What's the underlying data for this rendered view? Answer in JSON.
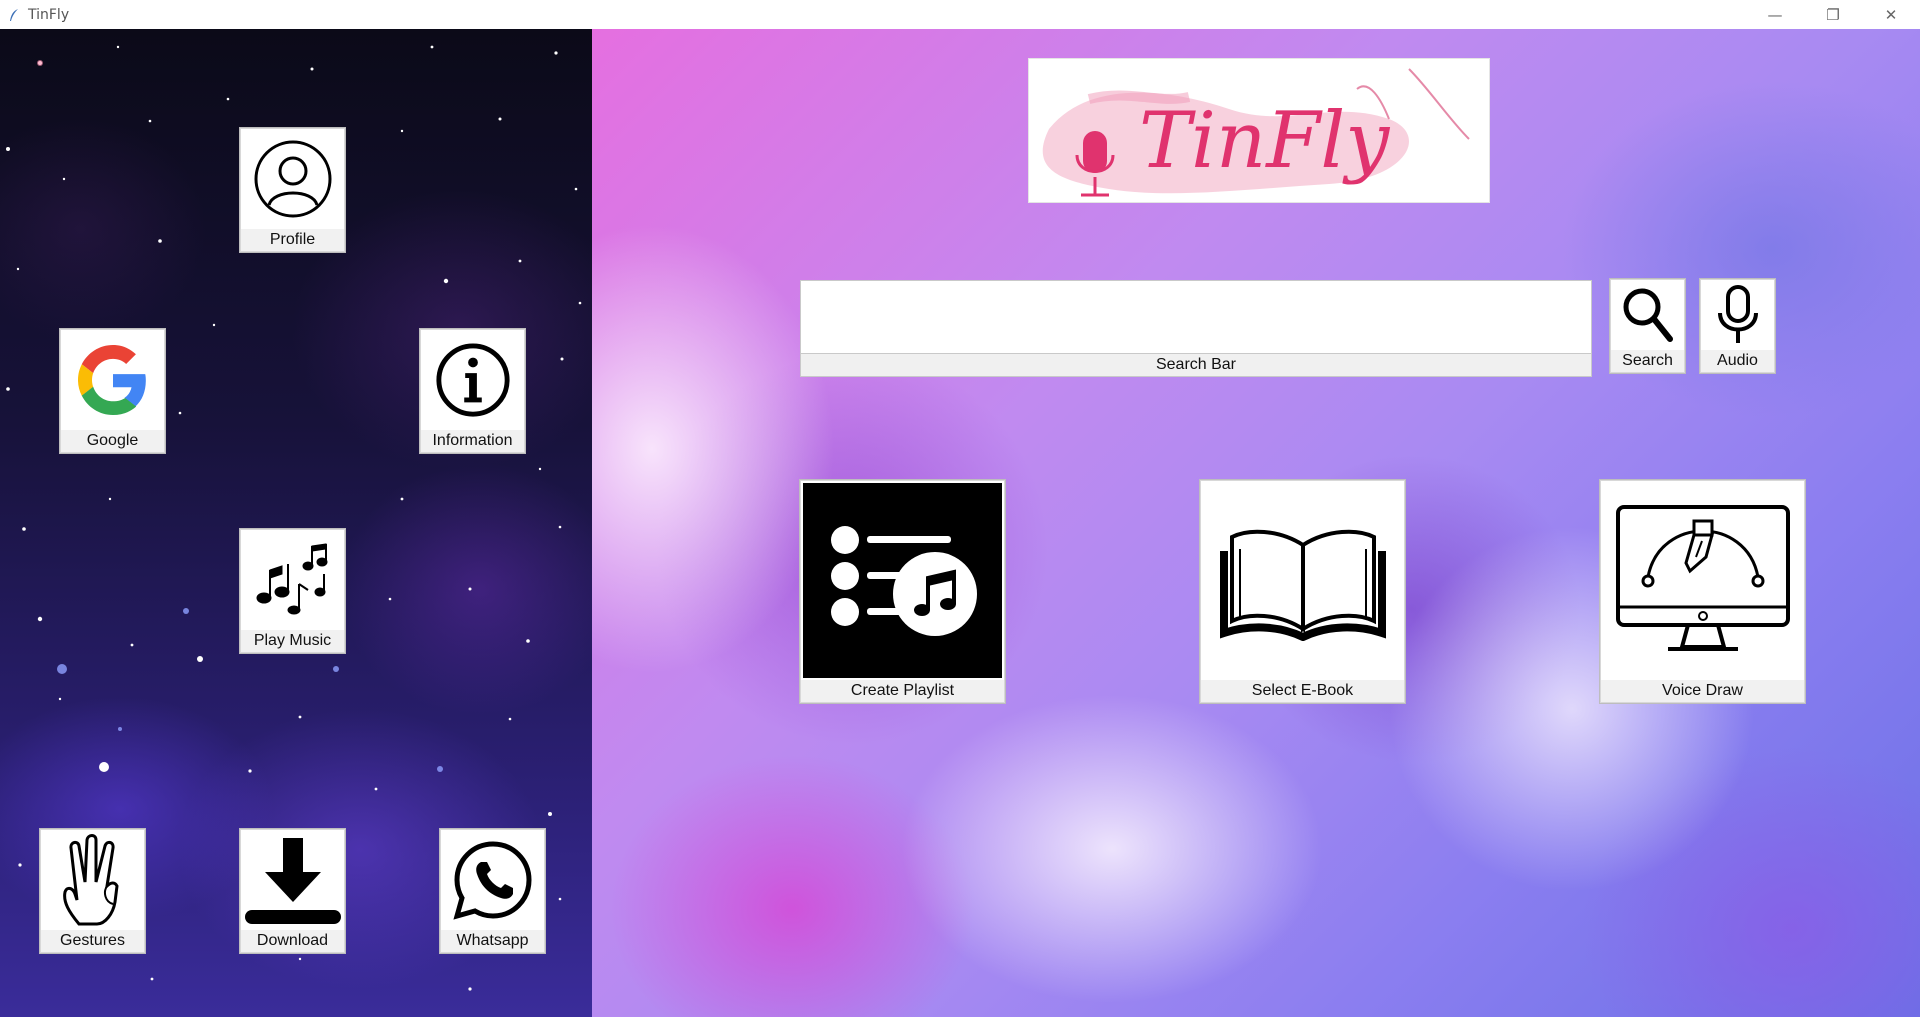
{
  "window": {
    "title": "TinFly",
    "minimize_glyph": "—",
    "restore_glyph": "❐",
    "close_glyph": "✕"
  },
  "logo": {
    "text": "TinFly"
  },
  "left_buttons": {
    "profile": "Profile",
    "google": "Google",
    "information": "Information",
    "play_music": "Play Music",
    "gestures": "Gestures",
    "download": "Download",
    "whatsapp": "Whatsapp"
  },
  "search": {
    "value": "",
    "label": "Search Bar",
    "search_button": "Search",
    "audio_button": "Audio"
  },
  "main_buttons": {
    "create_playlist": "Create Playlist",
    "select_ebook": "Select E-Book",
    "voice_draw": "Voice Draw"
  },
  "colors": {
    "logo_accent": "#e0336e",
    "left_bg": "#17123a",
    "right_bg": "#b08af0"
  }
}
